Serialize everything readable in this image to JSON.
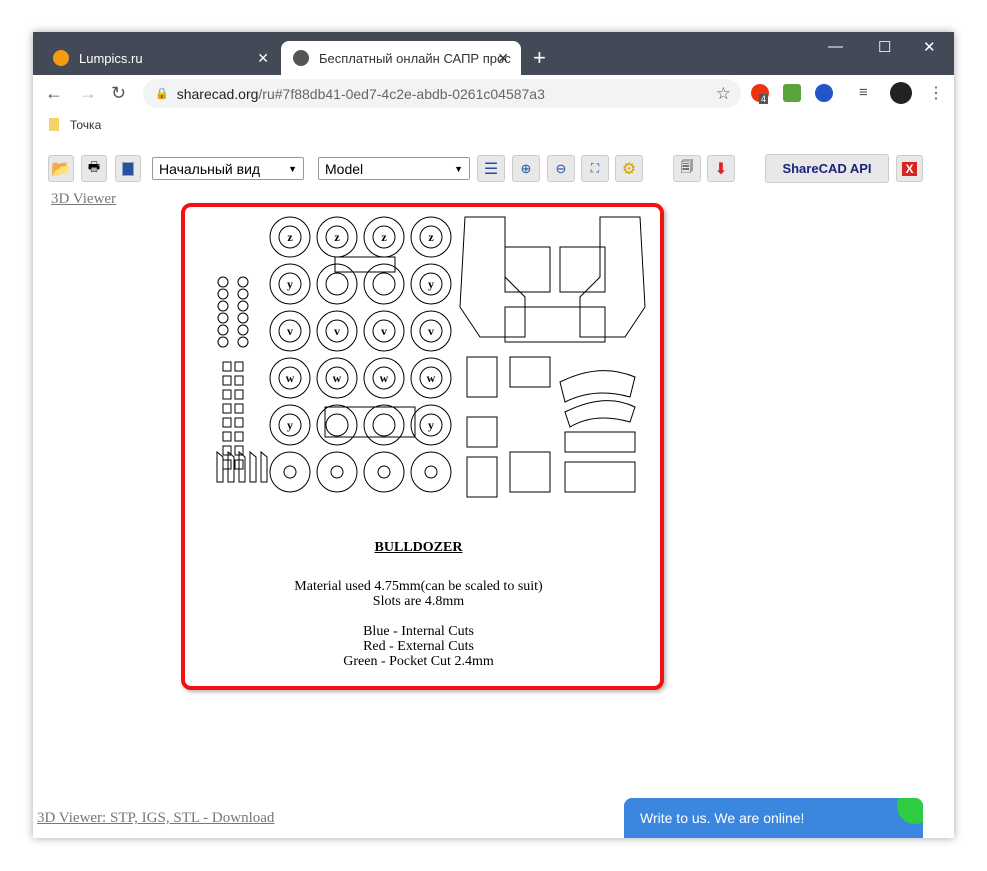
{
  "browser": {
    "tabs": [
      {
        "title": "Lumpics.ru"
      },
      {
        "title": "Бесплатный онлайн САПР прос"
      }
    ],
    "url_host": "sharecad.org",
    "url_path": "/ru#7f88db41-0ed7-4c2e-abdb-0261c04587a3",
    "extension_badge": "4",
    "bookmark": "Точка"
  },
  "toolbar": {
    "view_select": "Начальный вид",
    "layout_select": "Model",
    "api_button": "ShareCAD API"
  },
  "links": {
    "viewer3d": "3D Viewer",
    "download": "3D Viewer: STP, IGS, STL - Download"
  },
  "drawing": {
    "title": "BULLDOZER",
    "lines": [
      "Material used 4.75mm(can be scaled to suit)",
      "Slots are 4.8mm",
      "",
      "Blue - Internal Cuts",
      "Red - External Cuts",
      "Green - Pocket Cut 2.4mm"
    ],
    "wheel_rows": [
      [
        "z",
        "z",
        "z",
        "z"
      ],
      [
        "y",
        "",
        "",
        "y"
      ],
      [
        "v",
        "v",
        "v",
        "v"
      ],
      [
        "w",
        "w",
        "w",
        "w"
      ],
      [
        "y",
        "",
        "",
        "y"
      ]
    ]
  },
  "chat": {
    "label": "Write to us. We are online!"
  },
  "colors": {
    "tabbar": "#434957",
    "highlight": "#f21010",
    "chat": "#3b87e0"
  }
}
